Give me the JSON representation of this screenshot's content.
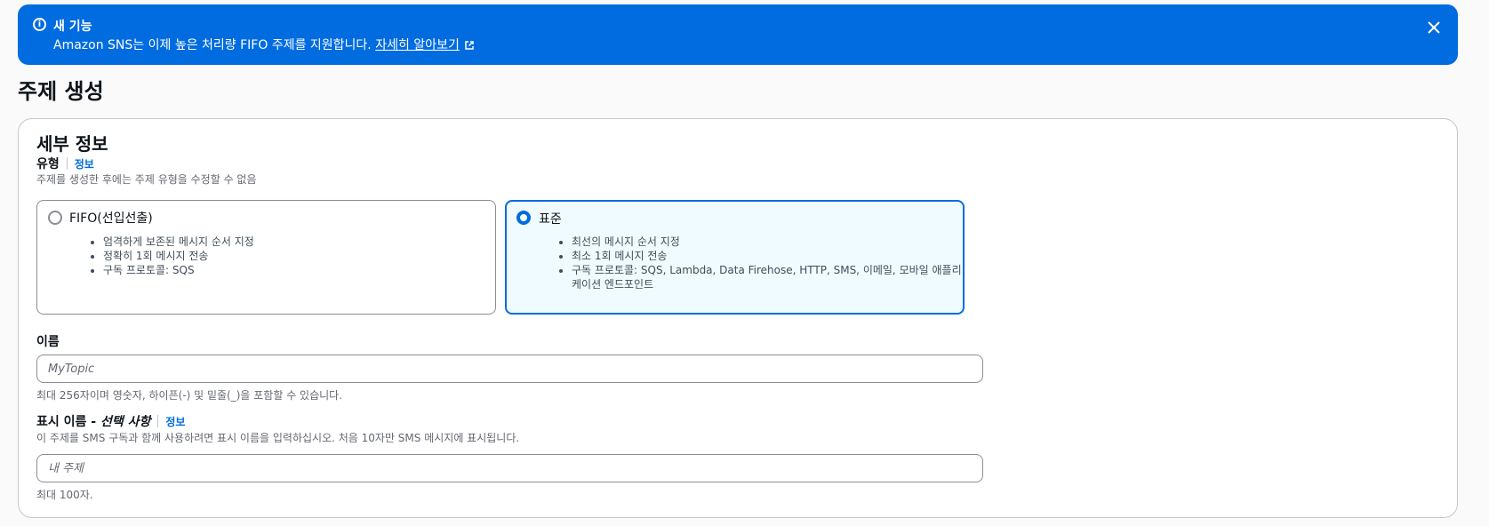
{
  "flash": {
    "title": "새 기능",
    "message": "Amazon SNS는 이제 높은 처리량 FIFO 주제를 지원합니다. ",
    "link": "자세히 알아보기",
    "info_icon": "info-icon",
    "close_icon": "close-icon",
    "external_icon": "external-link-icon"
  },
  "page": {
    "title": "주제 생성"
  },
  "details": {
    "title": "세부 정보",
    "type": {
      "label": "유형",
      "info": "정보",
      "hint": "주제를 생성한 후에는 주제 유형을 수정할 수 없음",
      "options": [
        {
          "label": "FIFO(선입선출)",
          "selected": false,
          "bullets": [
            "엄격하게 보존된 메시지 순서 지정",
            "정확히 1회 메시지 전송",
            "구독 프로토콜: SQS"
          ]
        },
        {
          "label": "표준",
          "selected": true,
          "bullets": [
            "최선의 메시지 순서 지정",
            "최소 1회 메시지 전송",
            "구독 프로토콜: SQS, Lambda, Data Firehose, HTTP, SMS, 이메일, 모바일 애플리케이션 엔드포인트"
          ]
        }
      ]
    },
    "name": {
      "label": "이름",
      "value": "",
      "placeholder": "MyTopic",
      "hint": "최대 256자이며 영숫자, 하이픈(-) 및 밑줄(_)을 포함할 수 있습니다."
    },
    "display_name": {
      "label": "표시 이름 - ",
      "optional": "선택 사항",
      "info": "정보",
      "description": "이 주제를 SMS 구독과 함께 사용하려면 표시 이름을 입력하십시오. 처음 10자만 SMS 메시지에 표시됩니다.",
      "value": "",
      "placeholder": "내 주제",
      "hint": "최대 100자."
    }
  }
}
